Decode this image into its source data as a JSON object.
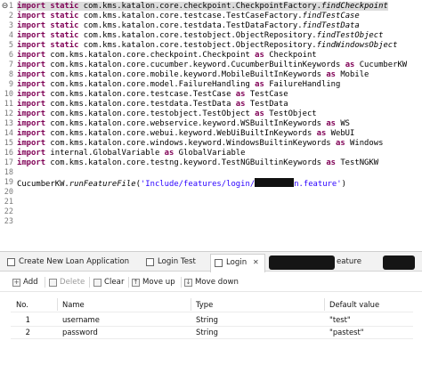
{
  "editor": {
    "line_numbers": [
      "1",
      "2",
      "3",
      "4",
      "5",
      "6",
      "7",
      "8",
      "9",
      "10",
      "11",
      "12",
      "13",
      "14",
      "15",
      "16",
      "17",
      "18",
      "19",
      "20",
      "21",
      "22",
      "23"
    ],
    "lines": [
      {
        "kw": "import static",
        "rest": " com.kms.katalon.core.checkpoint.CheckpointFactory.",
        "it": "findCheckpoint"
      },
      {
        "kw": "import static",
        "rest": " com.kms.katalon.core.testcase.TestCaseFactory.",
        "it": "findTestCase"
      },
      {
        "kw": "import static",
        "rest": " com.kms.katalon.core.testdata.TestDataFactory.",
        "it": "findTestData"
      },
      {
        "kw": "import static",
        "rest": " com.kms.katalon.core.testobject.ObjectRepository.",
        "it": "findTestObject"
      },
      {
        "kw": "import static",
        "rest": " com.kms.katalon.core.testobject.ObjectRepository.",
        "it": "findWindowsObject"
      },
      {
        "kw": "import",
        "rest": " com.kms.katalon.core.checkpoint.Checkpoint ",
        "as": "as",
        "alias": " Checkpoint"
      },
      {
        "kw": "import",
        "rest": " com.kms.katalon.core.cucumber.keyword.CucumberBuiltinKeywords ",
        "as": "as",
        "alias": " CucumberKW"
      },
      {
        "kw": "import",
        "rest": " com.kms.katalon.core.mobile.keyword.MobileBuiltInKeywords ",
        "as": "as",
        "alias": " Mobile"
      },
      {
        "kw": "import",
        "rest": " com.kms.katalon.core.model.FailureHandling ",
        "as": "as",
        "alias": " FailureHandling"
      },
      {
        "kw": "import",
        "rest": " com.kms.katalon.core.testcase.TestCase ",
        "as": "as",
        "alias": " TestCase"
      },
      {
        "kw": "import",
        "rest": " com.kms.katalon.core.testdata.TestData ",
        "as": "as",
        "alias": " TestData"
      },
      {
        "kw": "import",
        "rest": " com.kms.katalon.core.testobject.TestObject ",
        "as": "as",
        "alias": " TestObject"
      },
      {
        "kw": "import",
        "rest": " com.kms.katalon.core.webservice.keyword.WSBuiltInKeywords ",
        "as": "as",
        "alias": " WS"
      },
      {
        "kw": "import",
        "rest": " com.kms.katalon.core.webui.keyword.WebUiBuiltInKeywords ",
        "as": "as",
        "alias": " WebUI"
      },
      {
        "kw": "import",
        "rest": " com.kms.katalon.core.windows.keyword.WindowsBuiltinKeywords ",
        "as": "as",
        "alias": " Windows"
      },
      {
        "kw": "import",
        "rest": " internal.GlobalVariable ",
        "as": "as",
        "alias": " GlobalVariable"
      },
      {
        "kw": "import",
        "rest": " com.kms.katalon.core.testng.keyword.TestNGBuiltinKeywords ",
        "as": "as",
        "alias": " TestNGKW"
      }
    ],
    "call": {
      "object": "CucumberKW.",
      "method": "runFeatureFile",
      "open": "(",
      "string_start": "'Include/features/login/",
      "string_end": "n.feature'",
      "close": ")"
    }
  },
  "panel": {
    "tabs": [
      {
        "label": "Create New Loan Application",
        "active": false
      },
      {
        "label": "Login Test",
        "active": false
      },
      {
        "label": "Login",
        "active": true,
        "close": "✕"
      },
      {
        "label": "eature",
        "active": false
      }
    ],
    "toolbar": {
      "add": "Add",
      "delete": "Delete",
      "clear": "Clear",
      "move_up": "Move up",
      "move_down": "Move down"
    },
    "table": {
      "headers": [
        "No.",
        "Name",
        "Type",
        "Default value"
      ],
      "rows": [
        {
          "no": "1",
          "name": "username",
          "type": "String",
          "default": "\"test\""
        },
        {
          "no": "2",
          "name": "password",
          "type": "String",
          "default": "\"pastest\""
        }
      ]
    }
  }
}
